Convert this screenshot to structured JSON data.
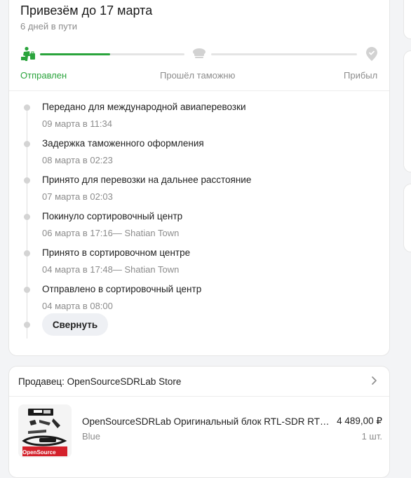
{
  "delivery": {
    "title": "Привезём до 17 марта",
    "subtitle": "6 дней в пути",
    "progress": 0.25,
    "steps": [
      {
        "label": "Отправлен",
        "status": "done",
        "icon": "person-with-luggage-icon"
      },
      {
        "label": "Прошёл таможню",
        "status": "pending",
        "icon": "customs-officer-cap-icon"
      },
      {
        "label": "Прибыл",
        "status": "pending",
        "icon": "location-pin-icon"
      }
    ]
  },
  "events": [
    {
      "title": "Передано для международной авиаперевозки",
      "time": "09 марта в 11:34"
    },
    {
      "title": "Задержка таможенного оформления",
      "time": "08 марта в 02:23"
    },
    {
      "title": "Принято для перевозки на дальнее расстояние",
      "time": "07 марта в 02:03"
    },
    {
      "title": "Покинуло сортировочный центр",
      "time": "06 марта в 17:16— Shatian Town"
    },
    {
      "title": "Принято в сортировочном центре",
      "time": "04 марта в 17:48— Shatian Town"
    },
    {
      "title": "Отправлено в сортировочный центр",
      "time": "04 марта в 08:00"
    }
  ],
  "collapse_label": "Свернуть",
  "seller": {
    "label": "Продавец: OpenSourceSDRLab Store"
  },
  "product": {
    "title": "OpenSourceSDRLab Оригинальный блок RTL-SDR RTL-SDR",
    "variant": "Blue",
    "price": "4 489,00 ₽",
    "qty": "1 шт.",
    "image_brand": "OpenSource"
  },
  "colors": {
    "accent_green": "#2aa43c",
    "muted": "#8c8c8c",
    "brand_red": "#d4212b"
  }
}
